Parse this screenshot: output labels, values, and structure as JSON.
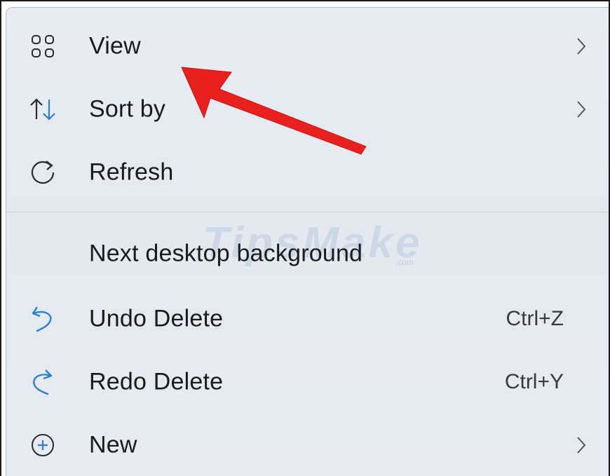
{
  "context_menu": {
    "items": [
      {
        "icon": "view-grid-icon",
        "label": "View",
        "has_submenu": true
      },
      {
        "icon": "sort-arrows-icon",
        "label": "Sort by",
        "has_submenu": true
      },
      {
        "icon": "refresh-icon",
        "label": "Refresh",
        "has_submenu": false
      },
      {
        "icon": "",
        "label": "Next desktop background",
        "has_submenu": false
      },
      {
        "icon": "undo-icon",
        "label": "Undo Delete",
        "shortcut": "Ctrl+Z"
      },
      {
        "icon": "redo-icon",
        "label": "Redo Delete",
        "shortcut": "Ctrl+Y"
      },
      {
        "icon": "add-circle-icon",
        "label": "New",
        "has_submenu": true
      }
    ]
  },
  "watermark": {
    "text": "TipsMake",
    "subtext": ".com"
  },
  "colors": {
    "menu_background": "#e6eaf0",
    "text": "#1b1b1b",
    "accent_icon": "#2a7fd4",
    "arrow": "#e8211f"
  }
}
